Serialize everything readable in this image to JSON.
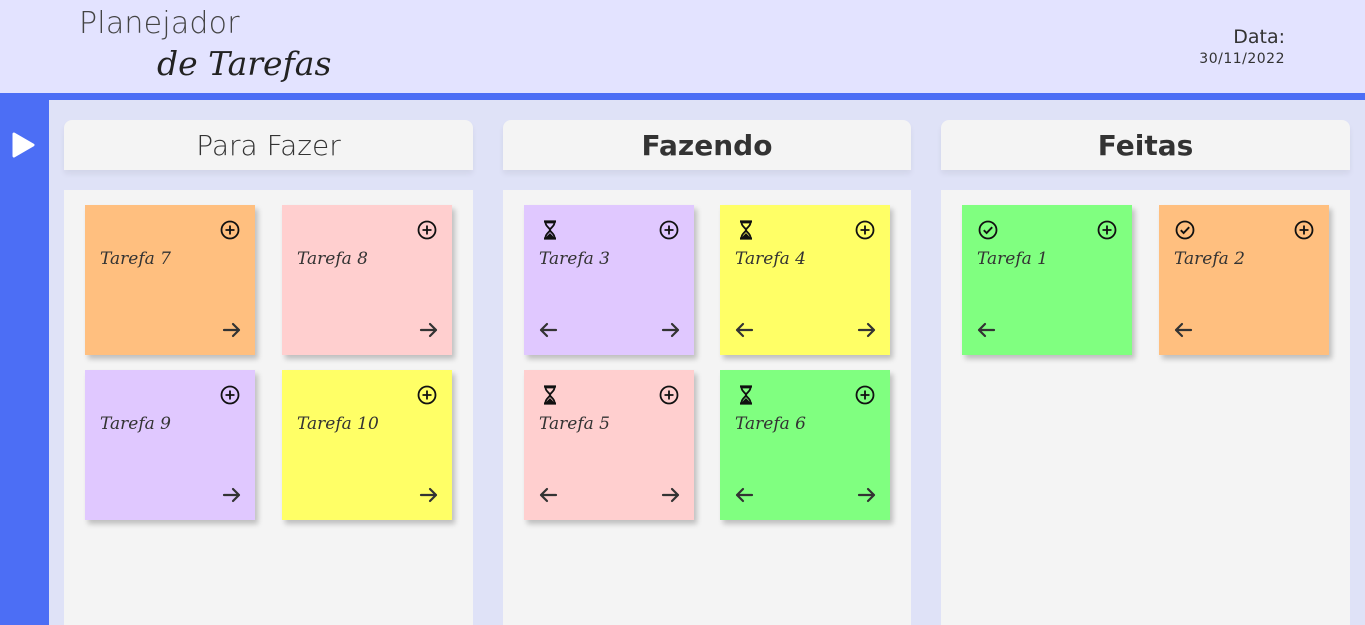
{
  "header": {
    "logo_line1": "Planejador",
    "logo_line2": "de Tarefas",
    "date_label": "Data:",
    "date_value": "30/11/2022"
  },
  "columns": [
    {
      "title": "Para Fazer",
      "cards": [
        {
          "title": "Tarefa 7",
          "color": "#ffbf7f"
        },
        {
          "title": "Tarefa 8",
          "color": "#ffcfcf"
        },
        {
          "title": "Tarefa 9",
          "color": "#e0c8ff"
        },
        {
          "title": "Tarefa 10",
          "color": "#ffff66"
        }
      ]
    },
    {
      "title": "Fazendo",
      "cards": [
        {
          "title": "Tarefa 3",
          "color": "#e0c8ff"
        },
        {
          "title": "Tarefa 4",
          "color": "#ffff66"
        },
        {
          "title": "Tarefa 5",
          "color": "#ffcfcf"
        },
        {
          "title": "Tarefa 6",
          "color": "#80ff80"
        }
      ]
    },
    {
      "title": "Feitas",
      "cards": [
        {
          "title": "Tarefa 1",
          "color": "#80ff80"
        },
        {
          "title": "Tarefa 2",
          "color": "#ffbf7f"
        }
      ]
    }
  ],
  "colors": {
    "accent": "#4c6ef5",
    "header_bg": "#e3e3ff",
    "column_bg": "#f4f4f4"
  },
  "icons": {
    "sidebar_toggle": "play-icon",
    "add": "plus-circle-icon",
    "in_progress": "hourglass-icon",
    "done": "check-circle-icon",
    "move_next": "arrow-right-icon",
    "move_prev": "arrow-left-icon"
  }
}
